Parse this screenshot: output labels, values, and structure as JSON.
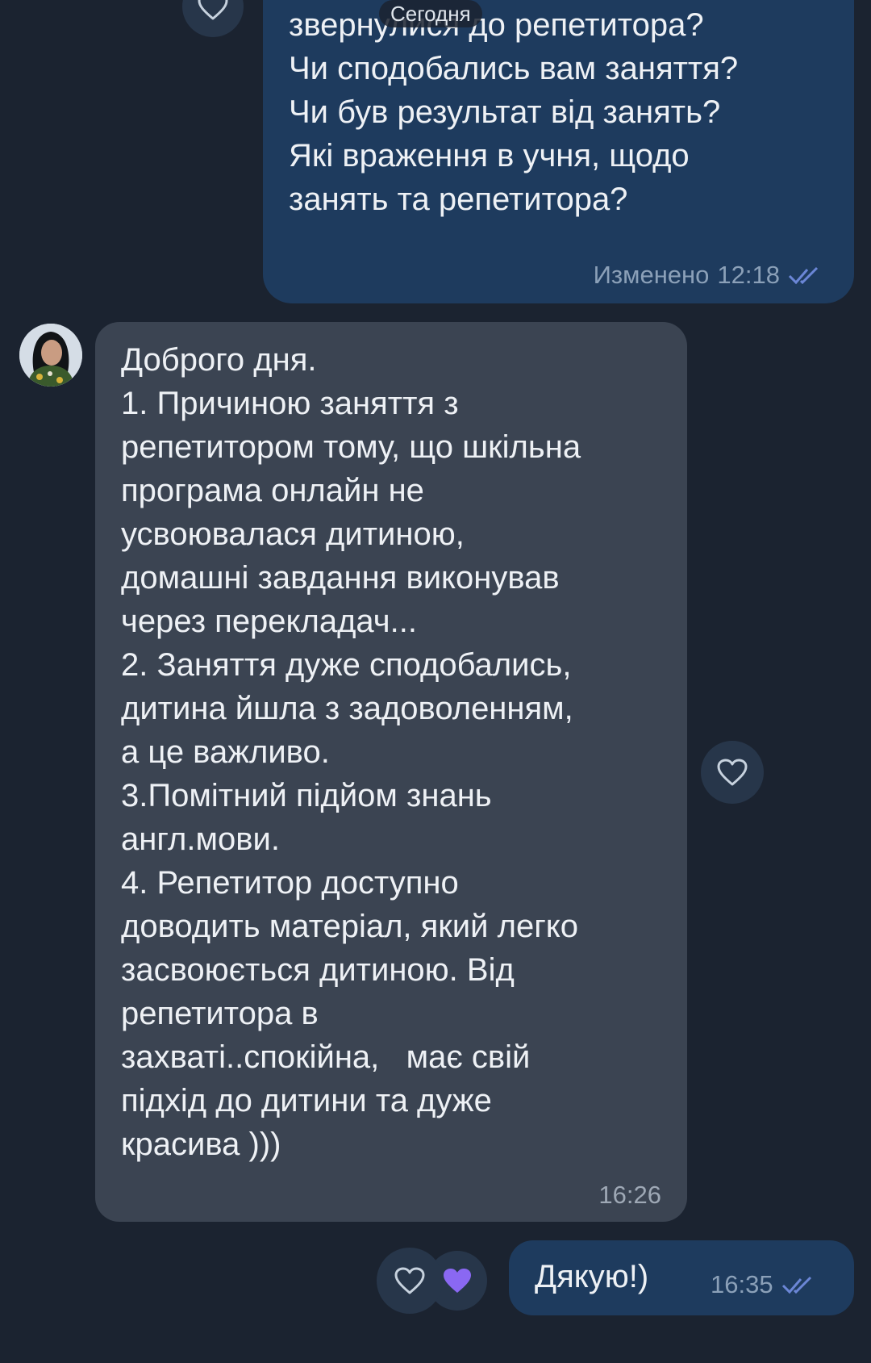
{
  "chat": {
    "date_separator": "Сегодня",
    "messages": [
      {
        "direction": "outgoing",
        "text": "Причина через яку ви\nзвернулися до репетитора?\nЧи сподобались вам заняття?\nЧи був результат від занять?\nЯкі враження в учня, щодо\nзанять та репетитора?",
        "edited_label": "Изменено",
        "time": "12:18",
        "status": "read"
      },
      {
        "direction": "incoming",
        "text": "Доброго дня.\n1. Причиною заняття з\nрепетитором тому, що шкільна\nпрограма онлайн не\nусвоювалася дитиною,\nдомашні завдання виконував\nчерез перекладач...\n2. Заняття дуже сподобались,\nдитина йшла з задоволенням,\nа це важливо.\n3.Помітний підйом знань\nангл.мови.\n4. Репетитор доступно\nдоводить матеріал, який легко\nзасвоюється дитиною. Від\nрепетитора в\nзахваті..спокійна,   має свій\nпідхід до дитини та дуже\nкрасива )))",
        "time": "16:26"
      },
      {
        "direction": "outgoing",
        "text": "Дякую!)",
        "time": "16:35",
        "status": "read",
        "reaction": "purple-heart"
      }
    ]
  },
  "colors": {
    "background": "#1b2330",
    "outgoing_bubble": "#1e3b5e",
    "incoming_bubble": "#3b4452",
    "read_check": "#6b86d6",
    "reaction_heart": "#8a68f2"
  },
  "icons": {
    "like": "heart-outline-icon",
    "reaction": "heart-filled-icon",
    "read_status": "double-check-icon"
  }
}
